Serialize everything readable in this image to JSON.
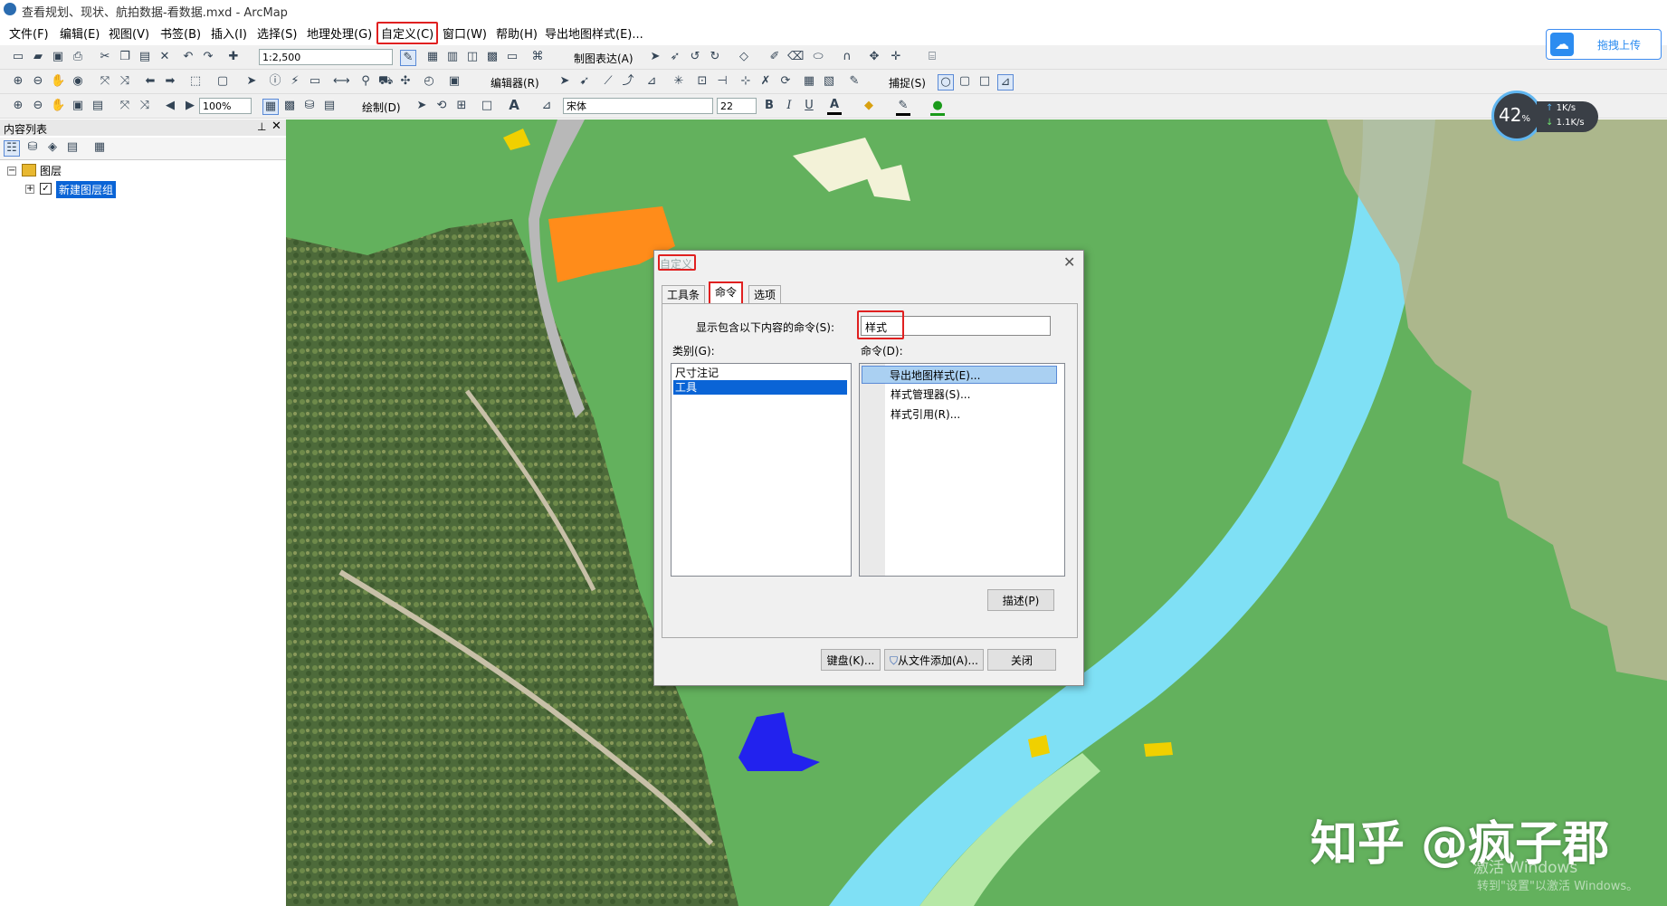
{
  "window": {
    "title": "查看规划、现状、航拍数据-看数据.mxd - ArcMap"
  },
  "menubar": {
    "items": [
      "文件(F)",
      "编辑(E)",
      "视图(V)",
      "书签(B)",
      "插入(I)",
      "选择(S)",
      "地理处理(G)",
      "自定义(C)",
      "窗口(W)",
      "帮助(H)",
      "导出地图样式(E)..."
    ],
    "highlighted": "自定义(C)"
  },
  "toolbar": {
    "scale": "1:2,500",
    "mapping_label": "制图表达(A)",
    "editor_label": "编辑器(R)",
    "snapping_label": "捕捉(S)",
    "zoom": "100%",
    "draw_label": "绘制(D)",
    "font": "宋体",
    "font_size": "22",
    "bold": "B",
    "italic": "I",
    "underline": "U",
    "text_tool": "A"
  },
  "upload": {
    "label": "拖拽上传"
  },
  "speed": {
    "percent": "42",
    "unit": "%",
    "up": "1",
    "down": "1.1",
    "rate_unit": "K/s"
  },
  "toc": {
    "title": "内容列表",
    "root_label": "图层",
    "group_label": "新建图层组"
  },
  "dialog": {
    "title": "自定义",
    "tabs": [
      "工具条",
      "命令",
      "选项"
    ],
    "active_tab": "命令",
    "filter_label": "显示包含以下内容的命令(S):",
    "filter_value": "样式",
    "category_label": "类别(G):",
    "categories": [
      "尺寸注记",
      "工具"
    ],
    "selected_category": "工具",
    "commands_label": "命令(D):",
    "commands": [
      "导出地图样式(E)...",
      "样式管理器(S)...",
      "样式引用(R)..."
    ],
    "selected_command": "导出地图样式(E)...",
    "describe_button": "描述(P)",
    "keyboard_button": "键盘(K)...",
    "add_from_file_button": "从文件添加(A)...",
    "close_button": "关闭"
  },
  "watermark": "知乎 @疯子郡",
  "activation": {
    "line1": "激活 Windows",
    "line2": "转到\"设置\"以激活 Windows。"
  },
  "colors": {
    "accent_red": "#e02020",
    "selection_blue": "#0a64d6",
    "map_green": "#63b15d",
    "water_cyan": "#7fe0f5",
    "upload_blue": "#2c8cf0"
  }
}
